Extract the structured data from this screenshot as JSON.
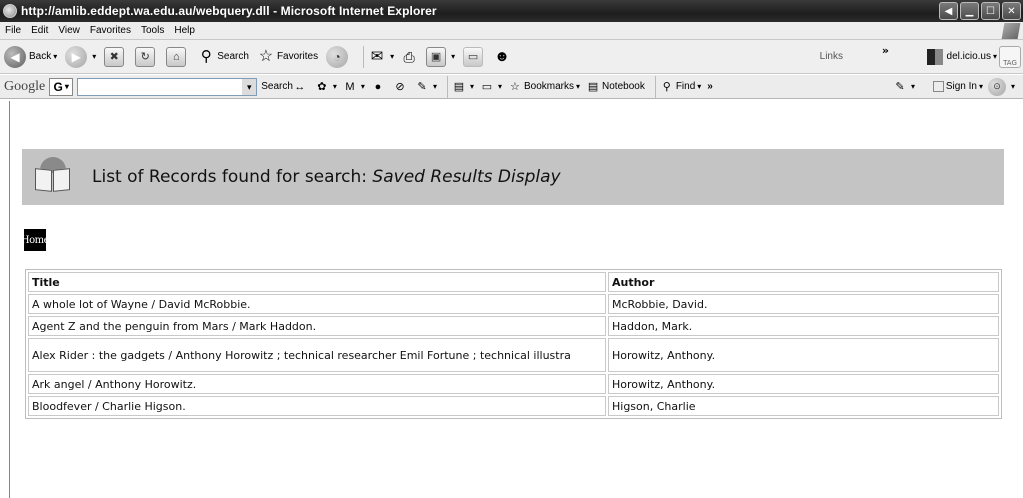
{
  "window": {
    "title": "http://amlib.eddept.wa.edu.au/webquery.dll - Microsoft Internet Explorer"
  },
  "menu": [
    "File",
    "Edit",
    "View",
    "Favorites",
    "Tools",
    "Help"
  ],
  "toolbar": {
    "back_label": "Back",
    "search_label": "Search",
    "favorites_label": "Favorites",
    "links_label": "Links",
    "delicious_label": "del.icio.us",
    "tag_label": "TAG"
  },
  "googlebar": {
    "logo": "Google",
    "g_button": "G",
    "search_label": "Search",
    "bookmarks_label": "Bookmarks",
    "notebook_label": "Notebook",
    "find_label": "Find",
    "signin_label": "Sign In"
  },
  "page": {
    "heading_prefix": "List of Records found for search: ",
    "heading_query": "Saved Results Display",
    "home_label": "Home",
    "table": {
      "headers": [
        "Title",
        "Author"
      ],
      "rows": [
        {
          "title": "A whole lot of Wayne / David McRobbie.",
          "author": "McRobbie, David."
        },
        {
          "title": "Agent Z and the penguin from Mars / Mark Haddon.",
          "author": "Haddon, Mark."
        },
        {
          "title": "Alex Rider : the gadgets / Anthony Horowitz ; technical researcher Emil Fortune ; technical illustra",
          "author": "Horowitz, Anthony."
        },
        {
          "title": "Ark angel / Anthony Horowitz.",
          "author": "Horowitz, Anthony."
        },
        {
          "title": "Bloodfever / Charlie Higson.",
          "author": "Higson, Charlie"
        }
      ]
    }
  }
}
